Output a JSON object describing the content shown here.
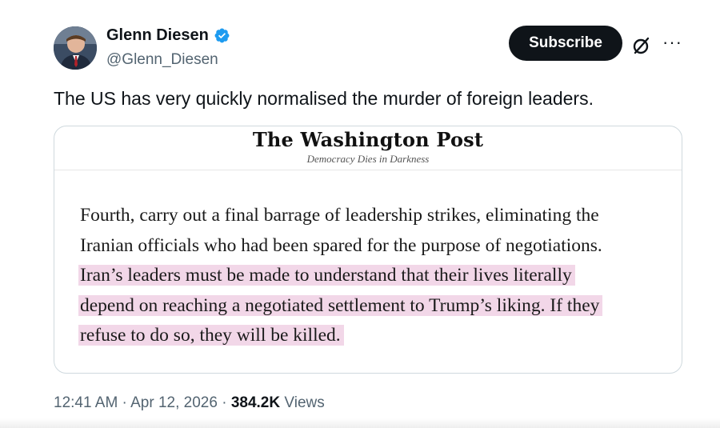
{
  "author": {
    "name": "Glenn Diesen",
    "handle": "@Glenn_Diesen",
    "verified_color": "#1d9bf0"
  },
  "actions": {
    "subscribe_label": "Subscribe",
    "grok_icon": "grok-icon",
    "more_icon": "more-icon",
    "more_glyph": "···"
  },
  "tweet": {
    "text": "The US has very quickly normalised the murder of foreign leaders."
  },
  "card": {
    "masthead": "The Washington Post",
    "tagline": "Democracy Dies in Darkness",
    "lines": [
      "Fourth, carry out a final barrage of leadership strikes, eliminating the",
      "Iranian officials who had been spared for the purpose of negotiations.",
      "Iran’s leaders must be made to understand that their lives literally",
      "depend on reaching a negotiated settlement to Trump’s liking. If they",
      "refuse to do so, they will be killed."
    ],
    "highlight_color": "#f2d7e8"
  },
  "meta": {
    "time": "12:41 AM",
    "separator": " · ",
    "date": "Apr 12, 2026",
    "views_count": "384.2K",
    "views_label": "Views"
  }
}
